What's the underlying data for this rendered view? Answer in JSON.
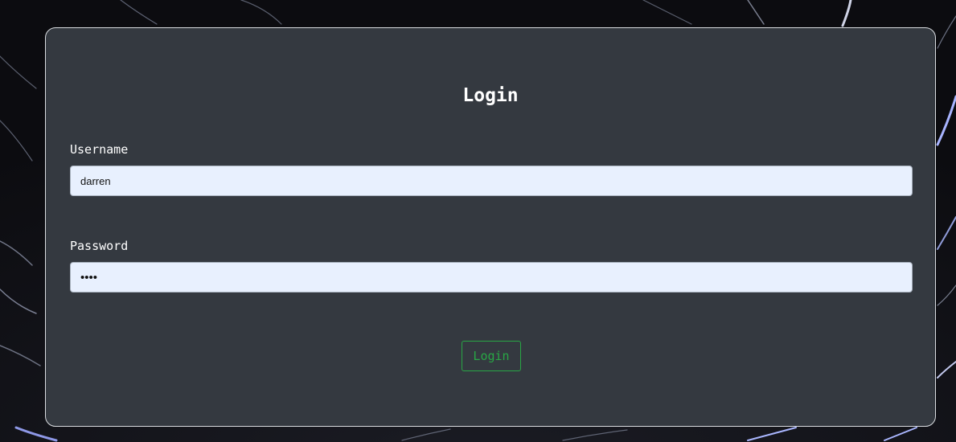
{
  "form": {
    "title": "Login",
    "username_label": "Username",
    "username_value": "darren",
    "password_label": "Password",
    "password_value": "••••",
    "submit_label": "Login"
  },
  "colors": {
    "card_background": "#343940",
    "input_background": "#e8f0fe",
    "button_accent": "#28a745",
    "text": "#ffffff"
  }
}
